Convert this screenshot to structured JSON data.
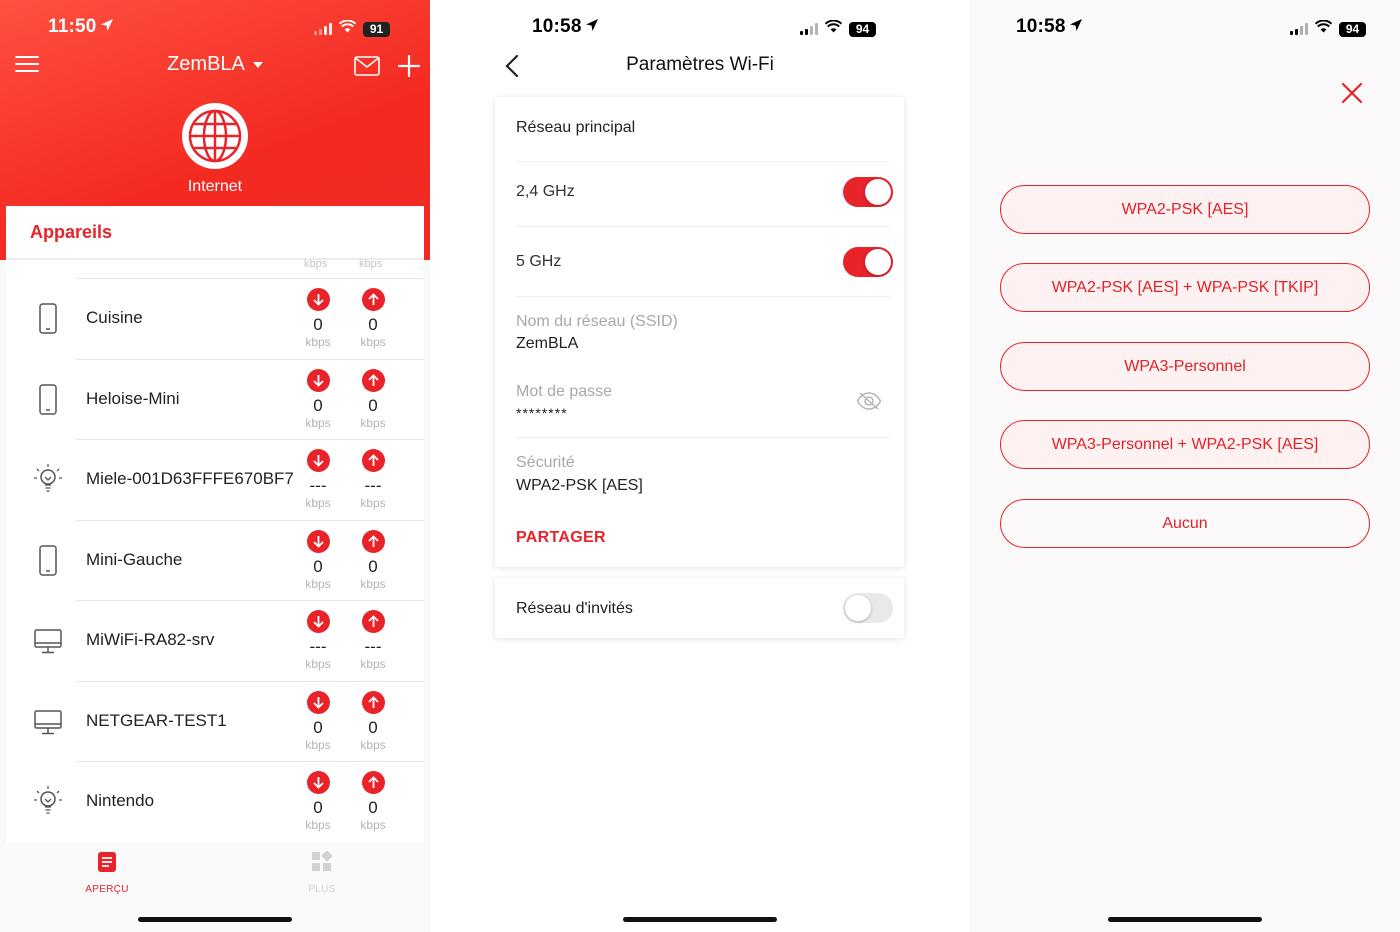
{
  "colors": {
    "accent": "#e8232a",
    "header_red": "#f32a22"
  },
  "panel1": {
    "status": {
      "time": "11:50",
      "battery": "91"
    },
    "header": {
      "network_name": "ZemBLA",
      "internet_label": "Internet"
    },
    "devices_title": "Appareils",
    "ghost_unit": "kbps",
    "devices": [
      {
        "name": "Cuisine",
        "icon": "phone-icon",
        "down": "0",
        "up": "0",
        "unit": "kbps"
      },
      {
        "name": "Heloise-Mini",
        "icon": "phone-icon",
        "down": "0",
        "up": "0",
        "unit": "kbps"
      },
      {
        "name": "Miele-001D63FFFE670BF7",
        "icon": "lightbulb-icon",
        "down": "---",
        "up": "---",
        "unit": "kbps"
      },
      {
        "name": "Mini-Gauche",
        "icon": "phone-icon",
        "down": "0",
        "up": "0",
        "unit": "kbps"
      },
      {
        "name": "MiWiFi-RA82-srv",
        "icon": "desktop-icon",
        "down": "---",
        "up": "---",
        "unit": "kbps"
      },
      {
        "name": "NETGEAR-TEST1",
        "icon": "desktop-icon",
        "down": "0",
        "up": "0",
        "unit": "kbps"
      },
      {
        "name": "Nintendo",
        "icon": "lightbulb-icon",
        "down": "0",
        "up": "0",
        "unit": "kbps"
      }
    ],
    "tabs": [
      {
        "label": "APERÇU",
        "icon": "document-icon",
        "active": true
      },
      {
        "label": "PLUS",
        "icon": "grid-icon",
        "active": false
      }
    ]
  },
  "panel2": {
    "status": {
      "time": "10:58",
      "battery": "94"
    },
    "title": "Paramètres Wi-Fi",
    "main_network": {
      "title": "Réseau principal",
      "band1_label": "2,4 GHz",
      "band1_on": true,
      "band2_label": "5 GHz",
      "band2_on": true,
      "ssid_label": "Nom du réseau (SSID)",
      "ssid_value": "ZemBLA",
      "password_label": "Mot de passe",
      "password_value": "********",
      "security_label": "Sécurité",
      "security_value": "WPA2-PSK [AES]",
      "share_label": "PARTAGER"
    },
    "guest_network": {
      "label": "Réseau d'invités",
      "on": false
    }
  },
  "panel3": {
    "status": {
      "time": "10:58",
      "battery": "94"
    },
    "options": [
      "WPA2-PSK [AES]",
      "WPA2-PSK [AES] + WPA-PSK [TKIP]",
      "WPA3-Personnel",
      "WPA3-Personnel + WPA2-PSK [AES]",
      "Aucun"
    ]
  }
}
